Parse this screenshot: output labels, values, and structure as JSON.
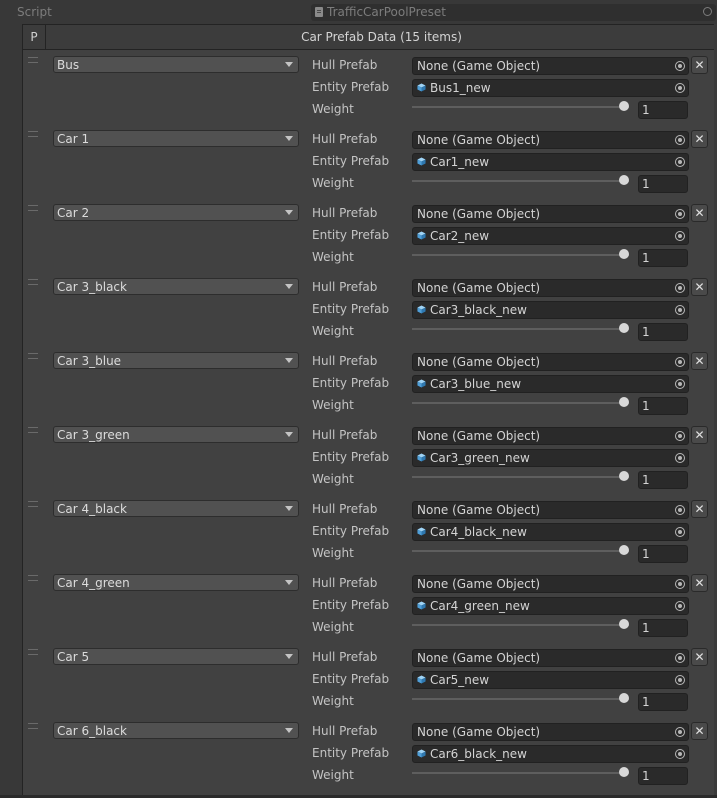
{
  "script": {
    "label": "Script",
    "value": "TrafficCarPoolPreset",
    "icon": "script-file-icon"
  },
  "list": {
    "p_header": "P",
    "title": "Car Prefab Data (15 items)",
    "labels": {
      "hull": "Hull Prefab",
      "entity": "Entity Prefab",
      "weight": "Weight"
    },
    "entries": [
      {
        "name": "Bus",
        "hull": "None (Game Object)",
        "entity": "Bus1_new",
        "weight": "1",
        "weight_fraction": 1.0
      },
      {
        "name": "Car 1",
        "hull": "None (Game Object)",
        "entity": "Car1_new",
        "weight": "1",
        "weight_fraction": 1.0
      },
      {
        "name": "Car 2",
        "hull": "None (Game Object)",
        "entity": "Car2_new",
        "weight": "1",
        "weight_fraction": 1.0
      },
      {
        "name": "Car 3_black",
        "hull": "None (Game Object)",
        "entity": "Car3_black_new",
        "weight": "1",
        "weight_fraction": 1.0
      },
      {
        "name": "Car 3_blue",
        "hull": "None (Game Object)",
        "entity": "Car3_blue_new",
        "weight": "1",
        "weight_fraction": 1.0
      },
      {
        "name": "Car 3_green",
        "hull": "None (Game Object)",
        "entity": "Car3_green_new",
        "weight": "1",
        "weight_fraction": 1.0
      },
      {
        "name": "Car 4_black",
        "hull": "None (Game Object)",
        "entity": "Car4_black_new",
        "weight": "1",
        "weight_fraction": 1.0
      },
      {
        "name": "Car 4_green",
        "hull": "None (Game Object)",
        "entity": "Car4_green_new",
        "weight": "1",
        "weight_fraction": 1.0
      },
      {
        "name": "Car 5",
        "hull": "None (Game Object)",
        "entity": "Car5_new",
        "weight": "1",
        "weight_fraction": 1.0
      },
      {
        "name": "Car 6_black",
        "hull": "None (Game Object)",
        "entity": "Car6_black_new",
        "weight": "1",
        "weight_fraction": 1.0
      }
    ]
  },
  "colors": {
    "background": "#383838",
    "field": "#2a2a2a",
    "prefab_icon": "#6fb4e8"
  }
}
